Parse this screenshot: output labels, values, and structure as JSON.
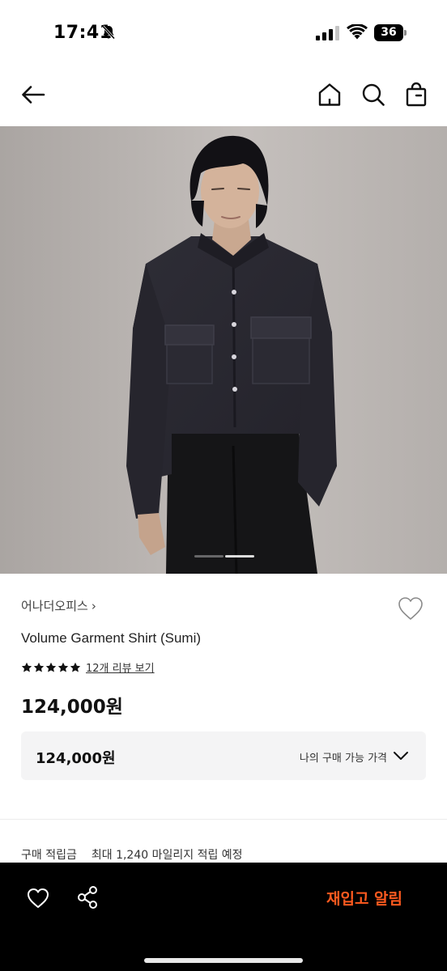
{
  "status_bar": {
    "time": "17:41",
    "battery_level": "36",
    "icons": [
      "bell-off-icon",
      "signal-icon",
      "wifi-icon",
      "battery-icon"
    ]
  },
  "nav": {
    "icons": [
      "back-arrow-icon",
      "home-icon",
      "search-icon",
      "shopping-bag-icon"
    ]
  },
  "gallery": {
    "current_index": 2,
    "total": 3
  },
  "product": {
    "brand": "어나더오피스",
    "brand_chevron": "›",
    "name": "Volume Garment Shirt (Sumi)",
    "rating_stars": 5,
    "review_link": "12개 리뷰 보기",
    "price": "124,000원",
    "my_price": "124,000원",
    "my_price_label": "나의 구매 가능 가격"
  },
  "mileage": {
    "label": "구매 적립금",
    "value": "최대 1,240 마일리지 적립 예정"
  },
  "bottom_bar": {
    "restock_label": "재입고 알림",
    "icons": [
      "heart-icon",
      "share-icon"
    ]
  },
  "colors": {
    "accent": "#ff5a1f",
    "bottom_bar_bg": "#000000",
    "price_box_bg": "#f4f4f5"
  }
}
